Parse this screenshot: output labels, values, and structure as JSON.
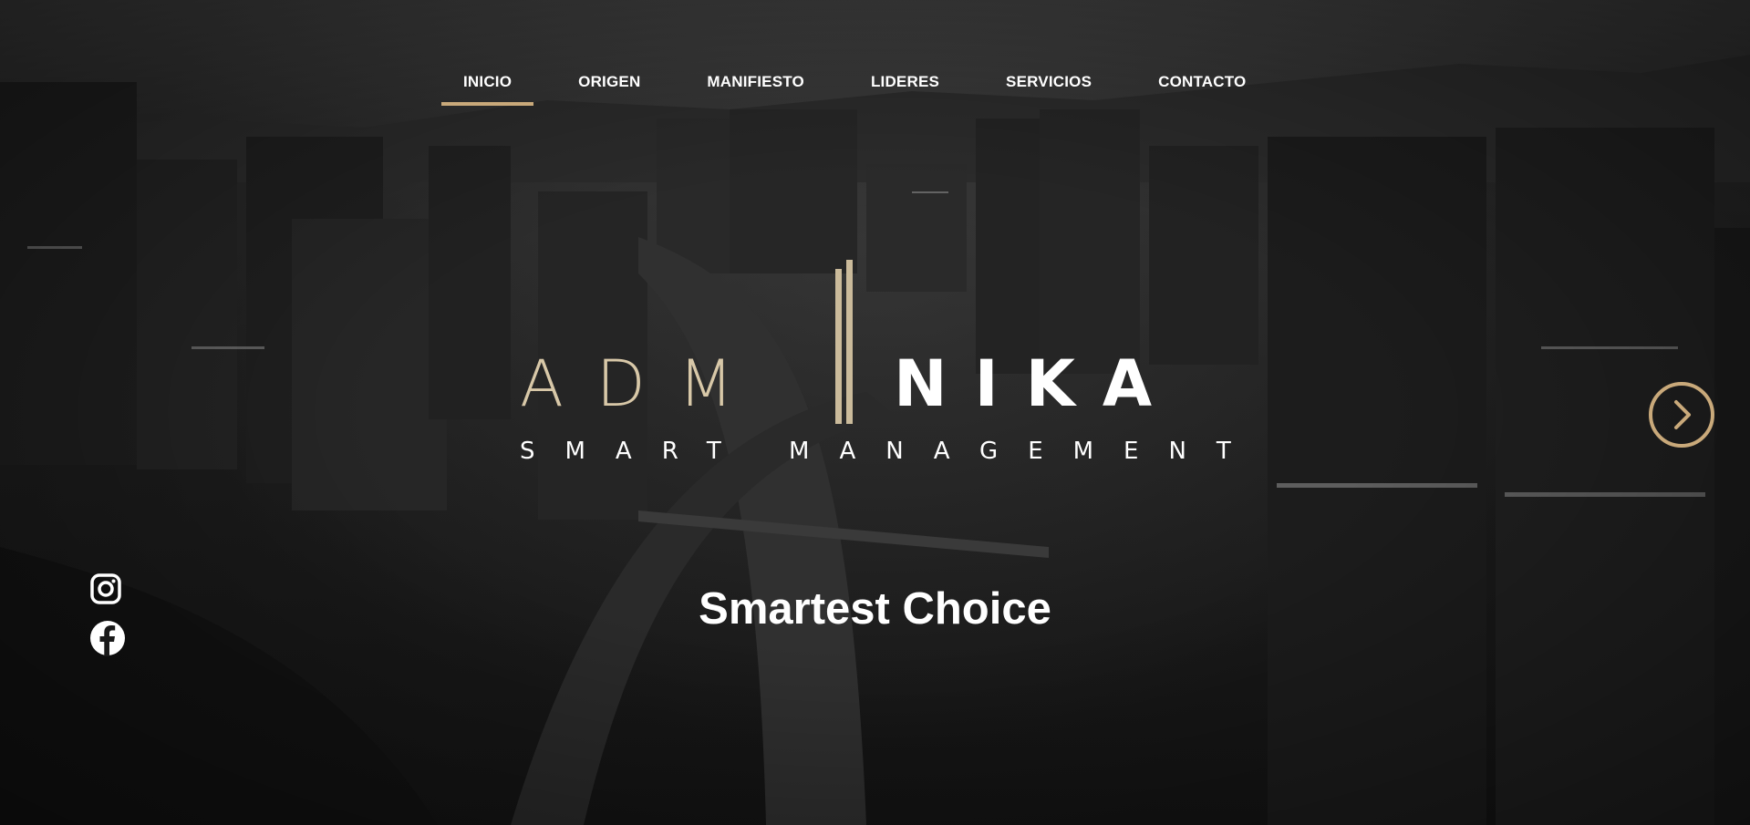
{
  "nav": {
    "items": [
      {
        "label": "INICIO",
        "active": true
      },
      {
        "label": "ORIGEN",
        "active": false
      },
      {
        "label": "MANIFIESTO",
        "active": false
      },
      {
        "label": "LIDERES",
        "active": false
      },
      {
        "label": "SERVICIOS",
        "active": false
      },
      {
        "label": "CONTACTO",
        "active": false
      }
    ]
  },
  "logo": {
    "wordmark_left": "ADM",
    "wordmark_right": "NIKA",
    "subtitle": "SMART MANAGEMENT"
  },
  "hero": {
    "tagline": "Smartest Choice",
    "background": "night-city-aerial"
  },
  "social": {
    "instagram_icon": "instagram-icon",
    "facebook_icon": "facebook-icon"
  },
  "carousel": {
    "next_icon": "chevron-right-circle-icon"
  },
  "colors": {
    "accent": "#c9a97a",
    "logo_gold": "#d8c8a8",
    "text": "#ffffff"
  }
}
